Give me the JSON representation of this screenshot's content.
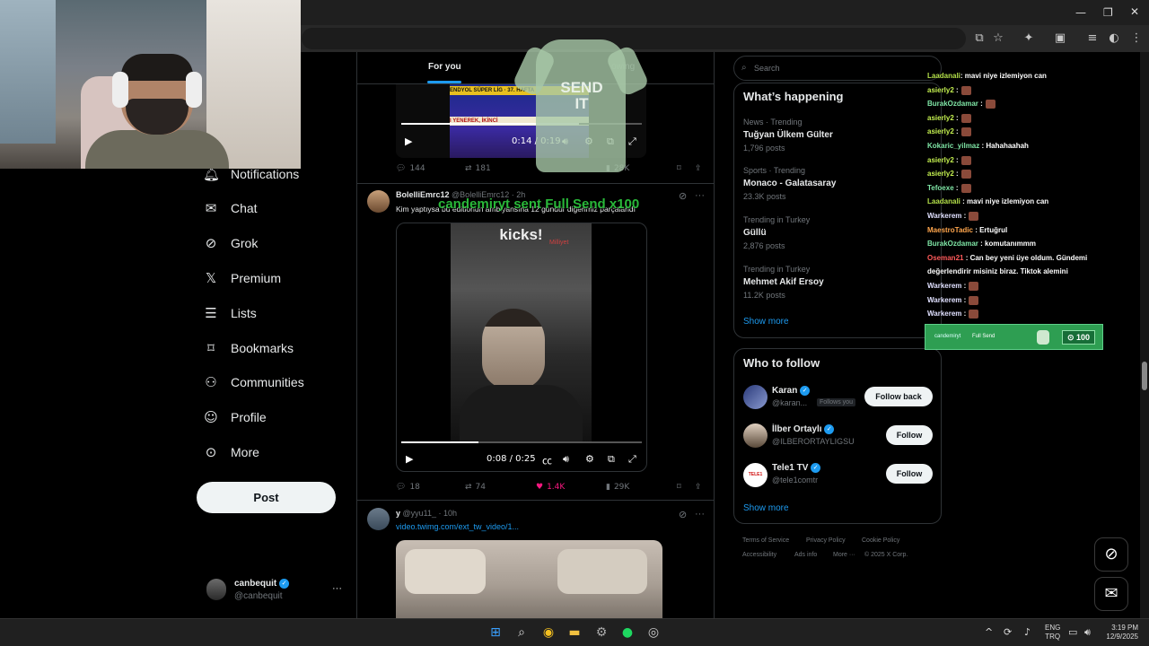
{
  "feed": {
    "tab_for_you": "For you",
    "tab_following": "owing",
    "tweet1": {
      "banner_line1": "ENDYOL SÜPER LİG · 37. HAFTA",
      "banner_line2": "I YENEREK, İKİNCİ",
      "time": "0:14 / 0:19",
      "replies": "144",
      "reposts": "181",
      "views": "28K"
    },
    "tweet2": {
      "name": "BolelliEmrc12",
      "handle": "@BolelliEmrc12 · 2h",
      "text": "Kim yaptıysa bu editionun ambiyansına 12 gündür diğerimiz parçalandı",
      "video_caption": "kicks!",
      "video_sub": "Milliyet",
      "time": "0:08 / 0:25",
      "replies": "18",
      "reposts": "74",
      "likes": "1.4K",
      "views": "29K"
    },
    "tweet3": {
      "name": "y",
      "handle": "@yyu11_ · 10h",
      "link": "video.twimg.com/ext_tw_video/1..."
    }
  },
  "overlay": {
    "alert_text": "candemiryt sent Full Send x100",
    "shirt_text": "SEND IT"
  },
  "nav": {
    "items": [
      "Notifications",
      "Chat",
      "Grok",
      "Premium",
      "Lists",
      "Bookmarks",
      "Communities",
      "Profile",
      "More"
    ],
    "icons": [
      "bell-icon",
      "envelope-icon",
      "grok-icon",
      "x-logo-icon",
      "list-icon",
      "bookmark-icon",
      "communities-icon",
      "person-icon",
      "more-circle-icon"
    ],
    "post_label": "Post",
    "profile_name": "canbequit",
    "profile_handle": "@canbequit",
    "more_dots": "···"
  },
  "right": {
    "search_placeholder": "Search",
    "whats_happening": "What’s happening",
    "trends": [
      {
        "meta": "News · Trending",
        "title": "Tuğyan Ülkem Gülter",
        "count": "1,796 posts"
      },
      {
        "meta": "Sports · Trending",
        "title": "Monaco - Galatasaray",
        "count": "23.3K posts"
      },
      {
        "meta": "Trending in Turkey",
        "title": "Güllü",
        "count": "2,876 posts"
      },
      {
        "meta": "Trending in Turkey",
        "title": "Mehmet Akif Ersoy",
        "count": "11.2K posts"
      }
    ],
    "show_more": "Show more",
    "who_to_follow": "Who to follow",
    "follow": [
      {
        "name": "Karan",
        "handle": "@karan...",
        "badge": "Follows you",
        "button": "Follow back"
      },
      {
        "name": "İlber Ortaylı",
        "handle": "@ILBERORTAYLIGSU",
        "badge": "",
        "button": "Follow"
      },
      {
        "name": "Tele1 TV",
        "handle": "@tele1comtr",
        "badge": "",
        "button": "Follow",
        "avatar_text": "TELE1"
      }
    ],
    "show_more2": "Show more",
    "footer": [
      "Terms of Service",
      "Privacy Policy",
      "Cookie Policy",
      "Accessibility",
      "Ads info",
      "More ···",
      "© 2025 X Corp."
    ]
  },
  "chat": [
    {
      "user": "Laadanali",
      "color": "#b4e04a",
      "msg": ": mavi niye izlemiyon can",
      "emote": false
    },
    {
      "user": "asierly2",
      "color": "#c4f050",
      "msg": " :",
      "emote": true
    },
    {
      "user": "BurakOzdamar",
      "color": "#7fe6a6",
      "msg": " :",
      "emote": true
    },
    {
      "user": "asierly2",
      "color": "#c4f050",
      "msg": " :",
      "emote": true
    },
    {
      "user": "asierly2",
      "color": "#c4f050",
      "msg": " :",
      "emote": true
    },
    {
      "user": "Kokaric_yilmaz",
      "color": "#7fe6a6",
      "msg": " : Hahahaahah",
      "emote": false
    },
    {
      "user": "asierly2",
      "color": "#c4f050",
      "msg": " :",
      "emote": true
    },
    {
      "user": "asierly2",
      "color": "#c4f050",
      "msg": " :",
      "emote": true
    },
    {
      "user": "Tefoexe",
      "color": "#7fe6a6",
      "msg": " :",
      "emote": true
    },
    {
      "user": "Laadanali",
      "color": "#b4e04a",
      "msg": " : mavi niye izlemiyon can",
      "emote": false
    },
    {
      "user": "Warkerem",
      "color": "#e0e0ff",
      "msg": " :",
      "emote": true
    },
    {
      "user": "MaestroTadic",
      "color": "#ffa64d",
      "msg": " : Ertuğrul",
      "emote": false
    },
    {
      "user": "BurakOzdamar",
      "color": "#7fe6a6",
      "msg": " : komutanımmm",
      "emote": false
    },
    {
      "user": "Oseman21",
      "color": "#ff5a5a",
      "msg": " : Can bey yeni üye oldum. Gündemi",
      "emote": false
    },
    {
      "user": "",
      "color": "#fff",
      "msg": "değerlendirir misiniz biraz. Tiktok alemini",
      "emote": false
    },
    {
      "user": "Warkerem",
      "color": "#e0e0ff",
      "msg": " :",
      "emote": true
    },
    {
      "user": "Warkerem",
      "color": "#e0e0ff",
      "msg": " :",
      "emote": true
    },
    {
      "user": "Warkerem",
      "color": "#e0e0ff",
      "msg": " :",
      "emote": true
    }
  ],
  "donation": {
    "user": "candemiryt",
    "item": "Full Send",
    "amount": "100"
  },
  "taskbar": {
    "lang1": "ENG",
    "lang2": "TRQ",
    "time": "3:19 PM",
    "date": "12/9/2025"
  }
}
